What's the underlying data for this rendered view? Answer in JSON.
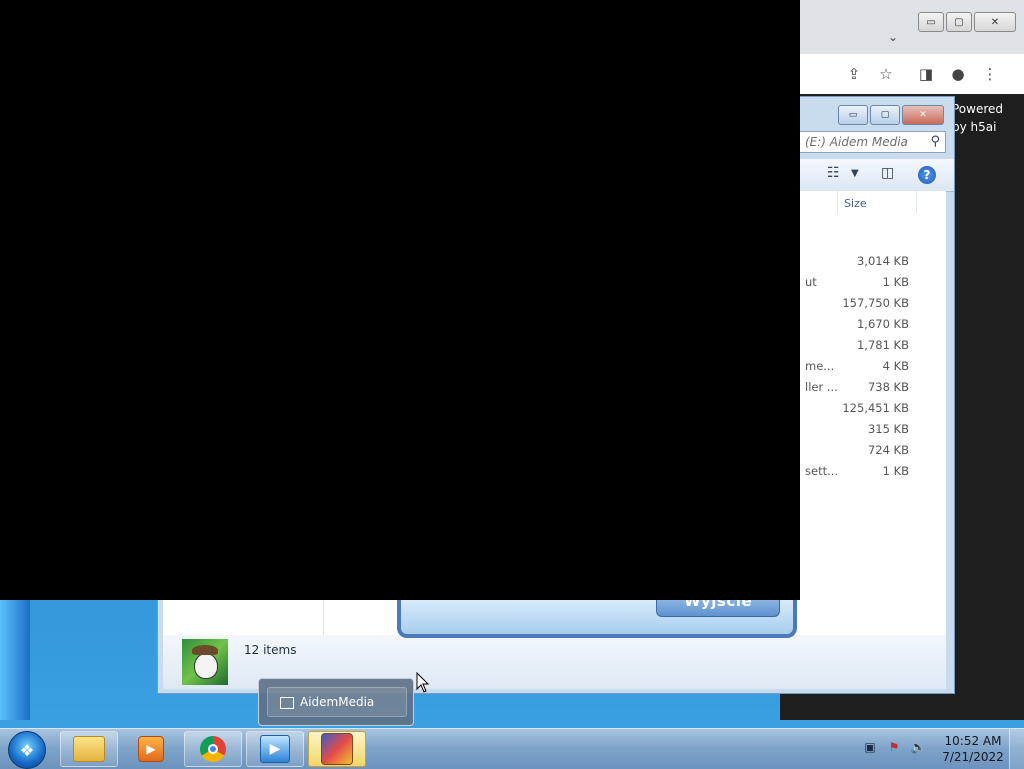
{
  "chrome": {
    "caption": {
      "minimize": "▭",
      "maximize": "▢",
      "close": "✕"
    },
    "tab_dropdown": "⌄",
    "page": {
      "h5ai_line1": "Powered",
      "h5ai_line2": "by h5ai"
    }
  },
  "explorer": {
    "caption": {
      "minimize": "▭",
      "maximize": "▢",
      "close": "✕"
    },
    "search_placeholder": "(E:) Aidem Media",
    "size_header": "Size",
    "rows": [
      {
        "name_fragment": "",
        "size": "3,014 KB"
      },
      {
        "name_fragment": "ut",
        "size": "1 KB"
      },
      {
        "name_fragment": "",
        "size": "157,750 KB"
      },
      {
        "name_fragment": "",
        "size": "1,670 KB"
      },
      {
        "name_fragment": "",
        "size": "1,781 KB"
      },
      {
        "name_fragment": "me...",
        "size": "4 KB"
      },
      {
        "name_fragment": "ller ...",
        "size": "738 KB"
      },
      {
        "name_fragment": "",
        "size": "125,451 KB"
      },
      {
        "name_fragment": "",
        "size": "315 KB"
      },
      {
        "name_fragment": "",
        "size": "724 KB"
      },
      {
        "name_fragment": "sett...",
        "size": "1 KB"
      }
    ],
    "status": "12 items"
  },
  "app_dialog": {
    "exit_label": "Wyjście"
  },
  "thumbnail_popup": {
    "label": "AidemMedia"
  },
  "taskbar": {
    "clock_time": "10:52 AM",
    "clock_date": "7/21/2022"
  },
  "colors": {
    "desktop": "#1a6fb6",
    "chrome_dark_page": "#1e1e1e",
    "taskbar": "#7ea3c9"
  }
}
